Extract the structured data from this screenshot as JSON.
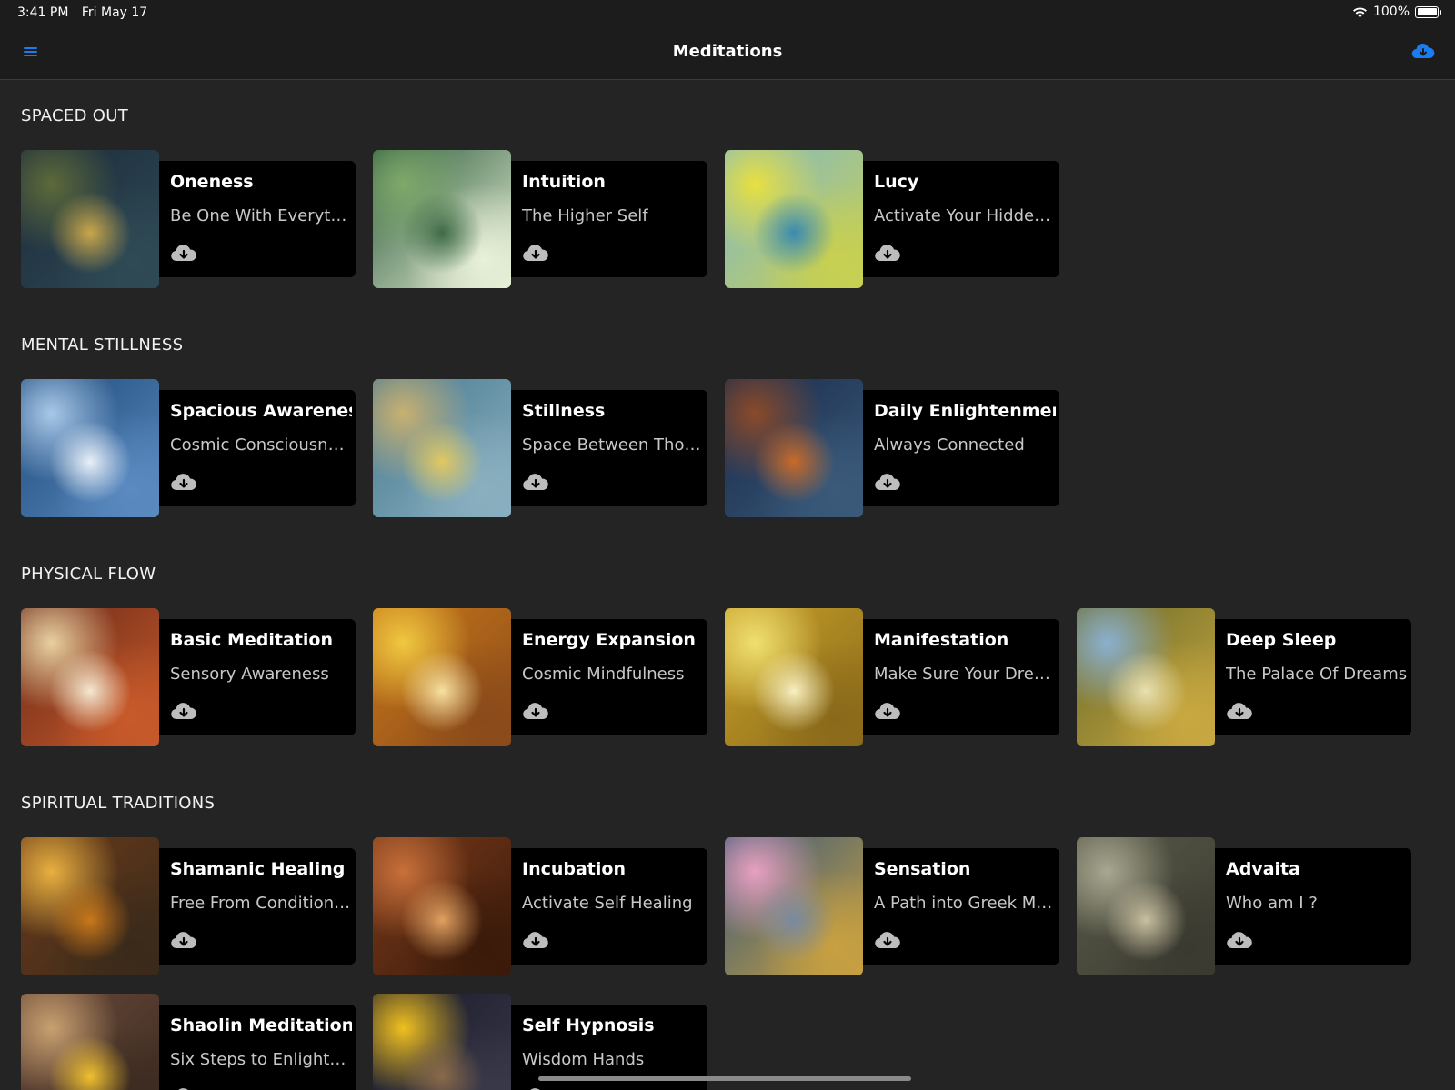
{
  "status": {
    "time": "3:41 PM",
    "date": "Fri May 17",
    "battery": "100%"
  },
  "nav": {
    "title": "Meditations",
    "menu_icon": "hamburger-icon",
    "cloud_icon": "cloud-download-icon"
  },
  "colors": {
    "accent": "#1a7cf0",
    "background": "#242424",
    "panel": "#000000"
  },
  "sections": [
    {
      "title": "SPACED OUT",
      "items": [
        {
          "title": "Oneness",
          "subtitle": "Be One With Everything",
          "art": [
            "#1b2a3a",
            "#5c6a3a",
            "#2f4a55",
            "#c9a74a"
          ]
        },
        {
          "title": "Intuition",
          "subtitle": "The Higher Self",
          "art": [
            "#2a5a3a",
            "#7fa86a",
            "#e8f0d8",
            "#3e6b45"
          ]
        },
        {
          "title": "Lucy",
          "subtitle": "Activate Your Hidden Potential",
          "art": [
            "#7fb8c8",
            "#e8e040",
            "#c8d050",
            "#3a8ab0"
          ]
        }
      ]
    },
    {
      "title": "MENTAL STILLNESS",
      "items": [
        {
          "title": "Spacious Awareness",
          "subtitle": "Cosmic Consciousness",
          "art": [
            "#1f4a7a",
            "#a8c8e8",
            "#5a8ac0",
            "#e8f0f8"
          ]
        },
        {
          "title": "Stillness",
          "subtitle": "Space Between Thoughts",
          "art": [
            "#4a7a90",
            "#c8b070",
            "#8ab0c0",
            "#e0c860"
          ]
        },
        {
          "title": "Daily Enlightenment",
          "subtitle": "Always Connected",
          "art": [
            "#1a2a4a",
            "#8a4a2a",
            "#3a5a7a",
            "#c86a2a"
          ]
        }
      ]
    },
    {
      "title": "PHYSICAL FLOW",
      "items": [
        {
          "title": "Basic Meditation",
          "subtitle": "Sensory Awareness",
          "art": [
            "#6a2a1a",
            "#e8d0a0",
            "#c85a2a",
            "#f4e8d0"
          ]
        },
        {
          "title": "Energy Expansion",
          "subtitle": "Cosmic Mindfulness",
          "art": [
            "#c8781a",
            "#f0c840",
            "#8a4a1a",
            "#f8e0a0"
          ]
        },
        {
          "title": "Manifestation",
          "subtitle": "Make Sure Your Dreams Come True",
          "art": [
            "#c8a02a",
            "#f0e070",
            "#8a6a1a",
            "#f8f0c0"
          ]
        },
        {
          "title": "Deep Sleep",
          "subtitle": "The Palace Of Dreams",
          "art": [
            "#6a6a2a",
            "#8ab0d0",
            "#c8a840",
            "#e8e0b0"
          ]
        }
      ]
    },
    {
      "title": "SPIRITUAL TRADITIONS",
      "items": [
        {
          "title": "Shamanic Healing",
          "subtitle": "Free From Conditioning",
          "art": [
            "#6a3a1a",
            "#e8b040",
            "#3a2a1a",
            "#c8781a"
          ]
        },
        {
          "title": "Incubation",
          "subtitle": "Activate Self Healing",
          "art": [
            "#7a3a1a",
            "#c8703a",
            "#3a1a0a",
            "#e0a060"
          ]
        },
        {
          "title": "Sensation",
          "subtitle": "A Path into Greek Mythology",
          "art": [
            "#3a5a7a",
            "#e8a0c0",
            "#c8a040",
            "#7a8aa0"
          ]
        },
        {
          "title": "Advaita",
          "subtitle": "Who am I ?",
          "art": [
            "#5a5a4a",
            "#a8a890",
            "#3a3a30",
            "#c8c0a0"
          ]
        }
      ]
    },
    {
      "title": "",
      "items": [
        {
          "title": "Shaolin Meditation",
          "subtitle": "Six Steps to Enlightenment",
          "art": [
            "#6a4a3a",
            "#c8a070",
            "#3a2a20",
            "#f0c030"
          ]
        },
        {
          "title": "Self Hypnosis",
          "subtitle": "Wisdom Hands",
          "art": [
            "#1a1a2a",
            "#f0c020",
            "#3a3a4a",
            "#8a6a4a"
          ]
        }
      ]
    }
  ]
}
